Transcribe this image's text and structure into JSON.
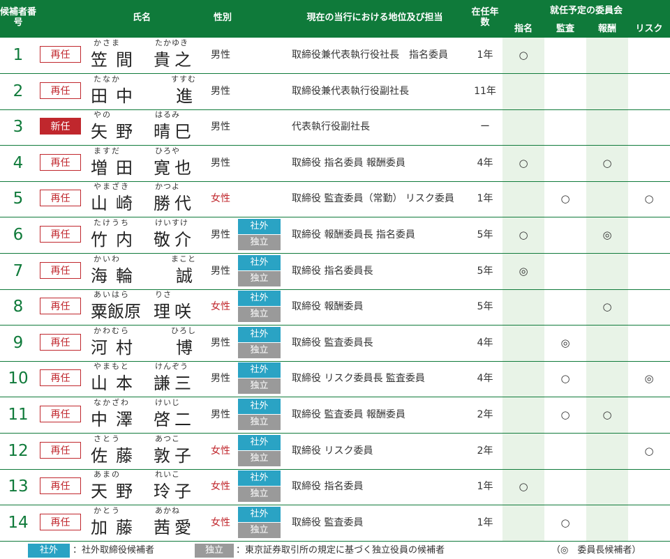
{
  "header": {
    "candidate_no": "候補者番号",
    "name": "氏名",
    "gender": "性別",
    "position": "現在の当行における地位及び担当",
    "tenure": "在任年数",
    "committees_title": "就任予定の委員会",
    "committees": [
      "指名",
      "監査",
      "報酬",
      "リスク"
    ]
  },
  "rows": [
    {
      "no": "1",
      "status": "再任",
      "new": false,
      "surname": "笠間",
      "given": "貴之",
      "fs": "かさま",
      "fg": "たかゆき",
      "gender": "男性",
      "female": false,
      "outside": "",
      "independent": "",
      "position": "取締役兼代表執行役社長　指名委員",
      "tenure": "1年",
      "c1": "○",
      "c2": "",
      "c3": "",
      "c4": ""
    },
    {
      "no": "2",
      "status": "再任",
      "new": false,
      "surname": "田中",
      "given": "進",
      "fs": "たなか",
      "fg": "すすむ",
      "gender": "男性",
      "female": false,
      "outside": "",
      "independent": "",
      "position": "取締役兼代表執行役副社長",
      "tenure": "11年",
      "c1": "",
      "c2": "",
      "c3": "",
      "c4": ""
    },
    {
      "no": "3",
      "status": "新任",
      "new": true,
      "surname": "矢野",
      "given": "晴巳",
      "fs": "やの",
      "fg": "はるみ",
      "gender": "男性",
      "female": false,
      "outside": "",
      "independent": "",
      "position": "代表執行役副社長",
      "tenure": "ー",
      "c1": "",
      "c2": "",
      "c3": "",
      "c4": ""
    },
    {
      "no": "4",
      "status": "再任",
      "new": false,
      "surname": "増田",
      "given": "寛也",
      "fs": "ますだ",
      "fg": "ひろや",
      "gender": "男性",
      "female": false,
      "outside": "",
      "independent": "",
      "position": "取締役 指名委員 報酬委員",
      "tenure": "4年",
      "c1": "○",
      "c2": "",
      "c3": "○",
      "c4": ""
    },
    {
      "no": "5",
      "status": "再任",
      "new": false,
      "surname": "山崎",
      "given": "勝代",
      "fs": "やまざき",
      "fg": "かつよ",
      "gender": "女性",
      "female": true,
      "outside": "",
      "independent": "",
      "position": "取締役 監査委員（常勤） リスク委員",
      "tenure": "1年",
      "c1": "",
      "c2": "○",
      "c3": "",
      "c4": "○"
    },
    {
      "no": "6",
      "status": "再任",
      "new": false,
      "surname": "竹内",
      "given": "敬介",
      "fs": "たけうち",
      "fg": "けいすけ",
      "gender": "男性",
      "female": false,
      "outside": "社外",
      "independent": "独立",
      "position": "取締役 報酬委員長 指名委員",
      "tenure": "5年",
      "c1": "○",
      "c2": "",
      "c3": "◎",
      "c4": ""
    },
    {
      "no": "7",
      "status": "再任",
      "new": false,
      "surname": "海輪",
      "given": "誠",
      "fs": "かいわ",
      "fg": "まこと",
      "gender": "男性",
      "female": false,
      "outside": "社外",
      "independent": "独立",
      "position": "取締役 指名委員長",
      "tenure": "5年",
      "c1": "◎",
      "c2": "",
      "c3": "",
      "c4": ""
    },
    {
      "no": "8",
      "status": "再任",
      "new": false,
      "surname": "粟飯原",
      "given": "理咲",
      "fs": "あいはら",
      "fg": "りさ",
      "gender": "女性",
      "female": true,
      "outside": "社外",
      "independent": "独立",
      "position": "取締役 報酬委員",
      "tenure": "5年",
      "c1": "",
      "c2": "",
      "c3": "○",
      "c4": ""
    },
    {
      "no": "9",
      "status": "再任",
      "new": false,
      "surname": "河村",
      "given": "博",
      "fs": "かわむら",
      "fg": "ひろし",
      "gender": "男性",
      "female": false,
      "outside": "社外",
      "independent": "独立",
      "position": "取締役 監査委員長",
      "tenure": "4年",
      "c1": "",
      "c2": "◎",
      "c3": "",
      "c4": ""
    },
    {
      "no": "10",
      "status": "再任",
      "new": false,
      "surname": "山本",
      "given": "謙三",
      "fs": "やまもと",
      "fg": "けんぞう",
      "gender": "男性",
      "female": false,
      "outside": "社外",
      "independent": "独立",
      "position": "取締役 リスク委員長 監査委員",
      "tenure": "4年",
      "c1": "",
      "c2": "○",
      "c3": "",
      "c4": "◎"
    },
    {
      "no": "11",
      "status": "再任",
      "new": false,
      "surname": "中澤",
      "given": "啓二",
      "fs": "なかざわ",
      "fg": "けいじ",
      "gender": "男性",
      "female": false,
      "outside": "社外",
      "independent": "独立",
      "position": "取締役 監査委員 報酬委員",
      "tenure": "2年",
      "c1": "",
      "c2": "○",
      "c3": "○",
      "c4": ""
    },
    {
      "no": "12",
      "status": "再任",
      "new": false,
      "surname": "佐藤",
      "given": "敦子",
      "fs": "さとう",
      "fg": "あつこ",
      "gender": "女性",
      "female": true,
      "outside": "社外",
      "independent": "独立",
      "position": "取締役 リスク委員",
      "tenure": "2年",
      "c1": "",
      "c2": "",
      "c3": "",
      "c4": "○"
    },
    {
      "no": "13",
      "status": "再任",
      "new": false,
      "surname": "天野",
      "given": "玲子",
      "fs": "あまの",
      "fg": "れいこ",
      "gender": "女性",
      "female": true,
      "outside": "社外",
      "independent": "独立",
      "position": "取締役 指名委員",
      "tenure": "1年",
      "c1": "○",
      "c2": "",
      "c3": "",
      "c4": ""
    },
    {
      "no": "14",
      "status": "再任",
      "new": false,
      "surname": "加藤",
      "given": "茜愛",
      "fs": "かとう",
      "fg": "あかね",
      "gender": "女性",
      "female": true,
      "outside": "社外",
      "independent": "独立",
      "position": "取締役 監査委員",
      "tenure": "1年",
      "c1": "",
      "c2": "○",
      "c3": "",
      "c4": ""
    }
  ],
  "legend": {
    "outside_badge": "社外",
    "outside_text": "：社外取締役候補者",
    "independent_badge": "独立",
    "independent_text": "：東京証券取引所の規定に基づく独立役員の候補者",
    "chair_note": "（◎　委員長候補者）"
  }
}
